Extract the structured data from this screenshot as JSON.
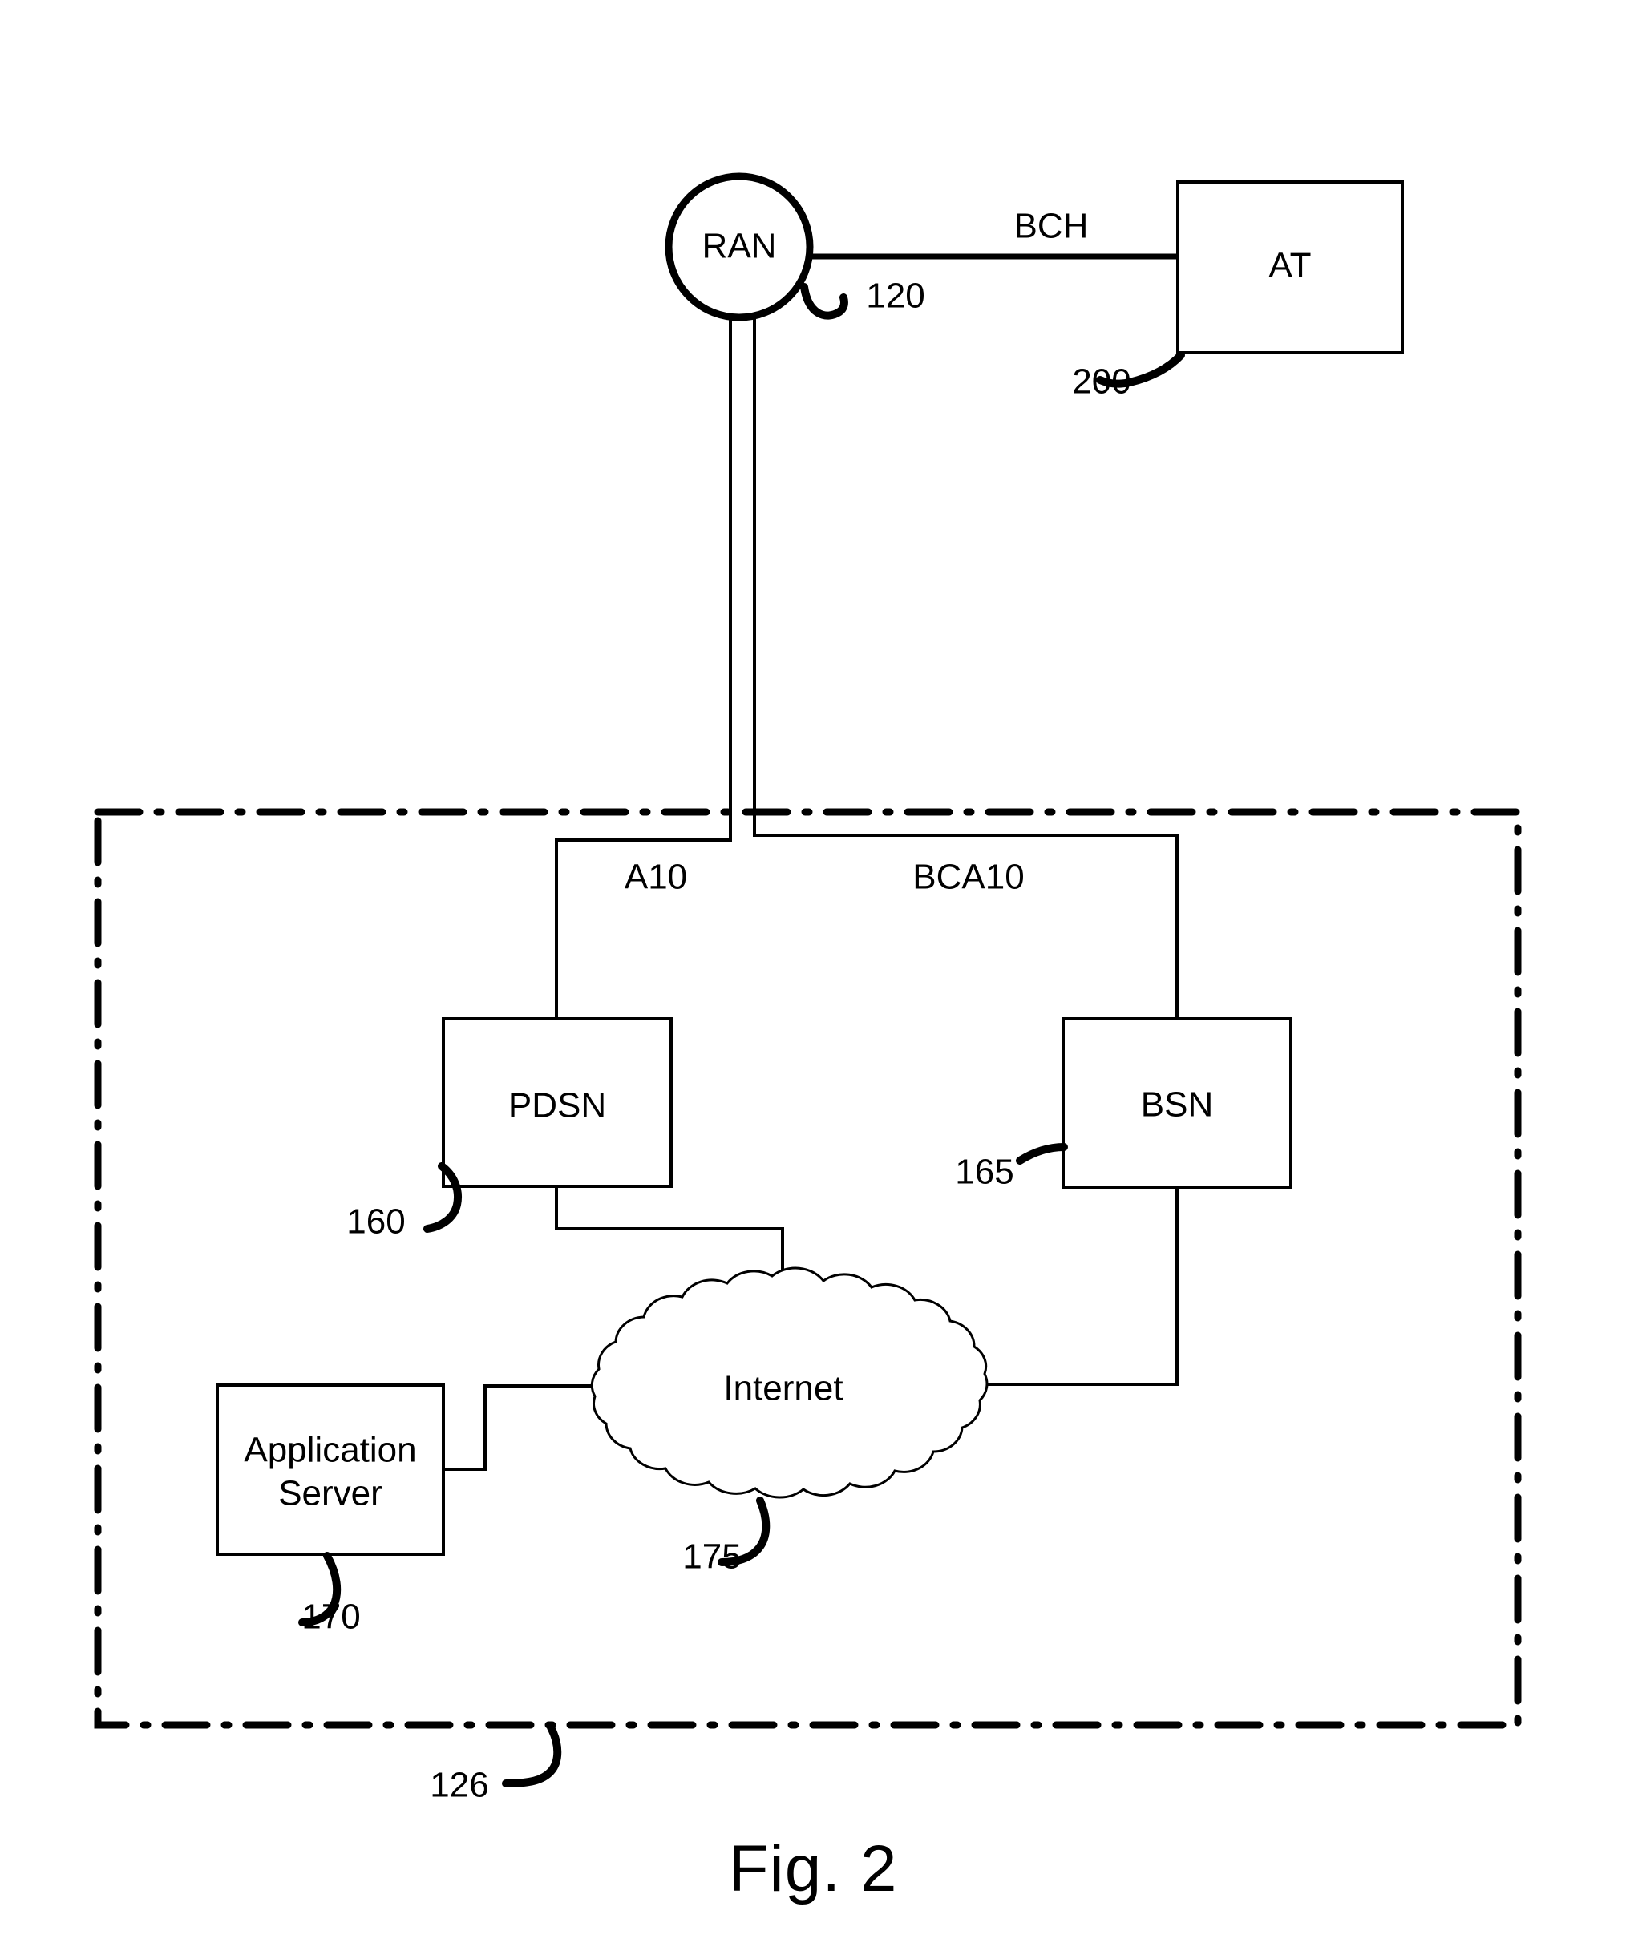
{
  "figure": {
    "caption": "Fig. 2",
    "type": "patent-network-diagram"
  },
  "nodes": {
    "ran": {
      "label": "RAN",
      "ref": "120",
      "shape": "circle"
    },
    "at": {
      "label": "AT",
      "ref": "200",
      "shape": "rectangle"
    },
    "pdsn": {
      "label": "PDSN",
      "ref": "160",
      "shape": "rectangle"
    },
    "bsn": {
      "label": "BSN",
      "ref": "165",
      "shape": "rectangle"
    },
    "internet": {
      "label": "Internet",
      "ref": "175",
      "shape": "cloud"
    },
    "app_server": {
      "label_line1": "Application",
      "label_line2": "Server",
      "ref": "170",
      "shape": "rectangle"
    }
  },
  "links": {
    "bch": {
      "label": "BCH",
      "from": "ran",
      "to": "at"
    },
    "a10": {
      "label": "A10",
      "from": "ran",
      "to": "pdsn"
    },
    "bca10": {
      "label": "BCA10",
      "from": "ran",
      "to": "bsn"
    }
  },
  "boundary": {
    "ref": "126",
    "style": "dash-dot"
  },
  "colors": {
    "stroke": "#000000",
    "background": "#ffffff"
  }
}
